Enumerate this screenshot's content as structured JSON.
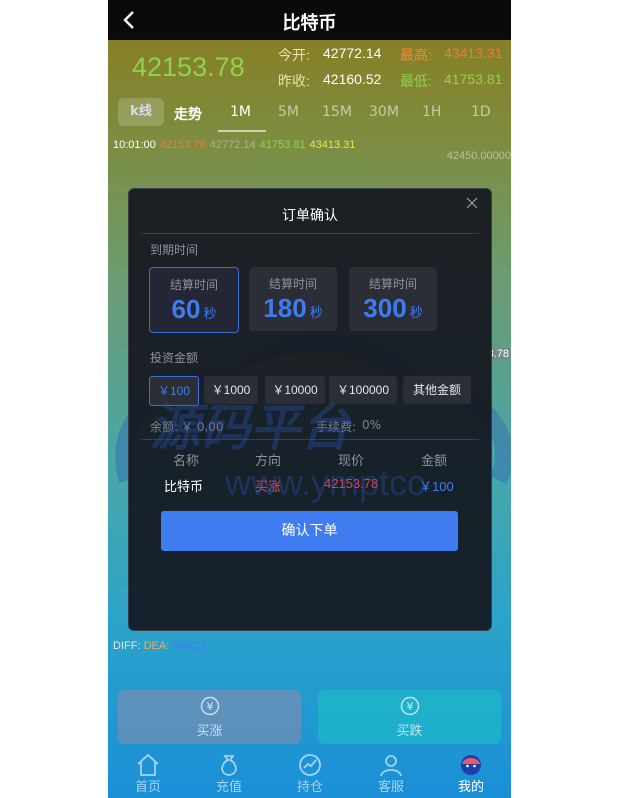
{
  "header": {
    "title": "比特币"
  },
  "quote": {
    "last_price": "42153.78",
    "open_label": "今开:",
    "open_value": "42772.14",
    "high_label": "最高:",
    "high_value": "43413.31",
    "prev_label": "昨收:",
    "prev_value": "42160.52",
    "low_label": "最低:",
    "low_value": "41753.81"
  },
  "tabs": {
    "kline": "k线",
    "trend": "走势",
    "periods": [
      "1M",
      "5M",
      "15M",
      "30M",
      "1H",
      "1D"
    ]
  },
  "chart_info": {
    "time": "10:01:00",
    "v1": "42153.78",
    "v2": "42772.14",
    "v3": "41753.81",
    "v4": "43413.31",
    "axis_top": "42450.00000",
    "axis_mid": "3.78"
  },
  "indicator": {
    "diff": "DIFF:",
    "dea": "DEA:",
    "macd": "MACD:"
  },
  "modal": {
    "title": "订单确认",
    "expiry_label": "到期时间",
    "settle_label": "结算时间",
    "durations": [
      {
        "value": "60",
        "unit": "秒"
      },
      {
        "value": "180",
        "unit": "秒"
      },
      {
        "value": "300",
        "unit": "秒"
      }
    ],
    "invest_label": "投资金额",
    "amounts": [
      "￥100",
      "￥1000",
      "￥10000",
      "￥100000",
      "其他金额"
    ],
    "balance_label": "余额:",
    "balance_value": "￥ 0.00",
    "fee_label": "手续费:",
    "fee_value": "0%",
    "table_headers": [
      "名称",
      "方向",
      "现价",
      "金额"
    ],
    "row": {
      "name": "比特币",
      "direction": "买涨",
      "price": "42153.78",
      "amount": "￥100"
    },
    "confirm": "确认下单"
  },
  "watermark": {
    "text_cn": "源码平台",
    "text_url": "www.ymptcc"
  },
  "actions": {
    "buy_up": "买涨",
    "buy_down": "买跌"
  },
  "nav": [
    "首页",
    "充值",
    "持仓",
    "客服",
    "我的"
  ],
  "colors": {
    "accent": "#3f7cf0",
    "up": "#e2455a",
    "green": "#8fd34a"
  }
}
